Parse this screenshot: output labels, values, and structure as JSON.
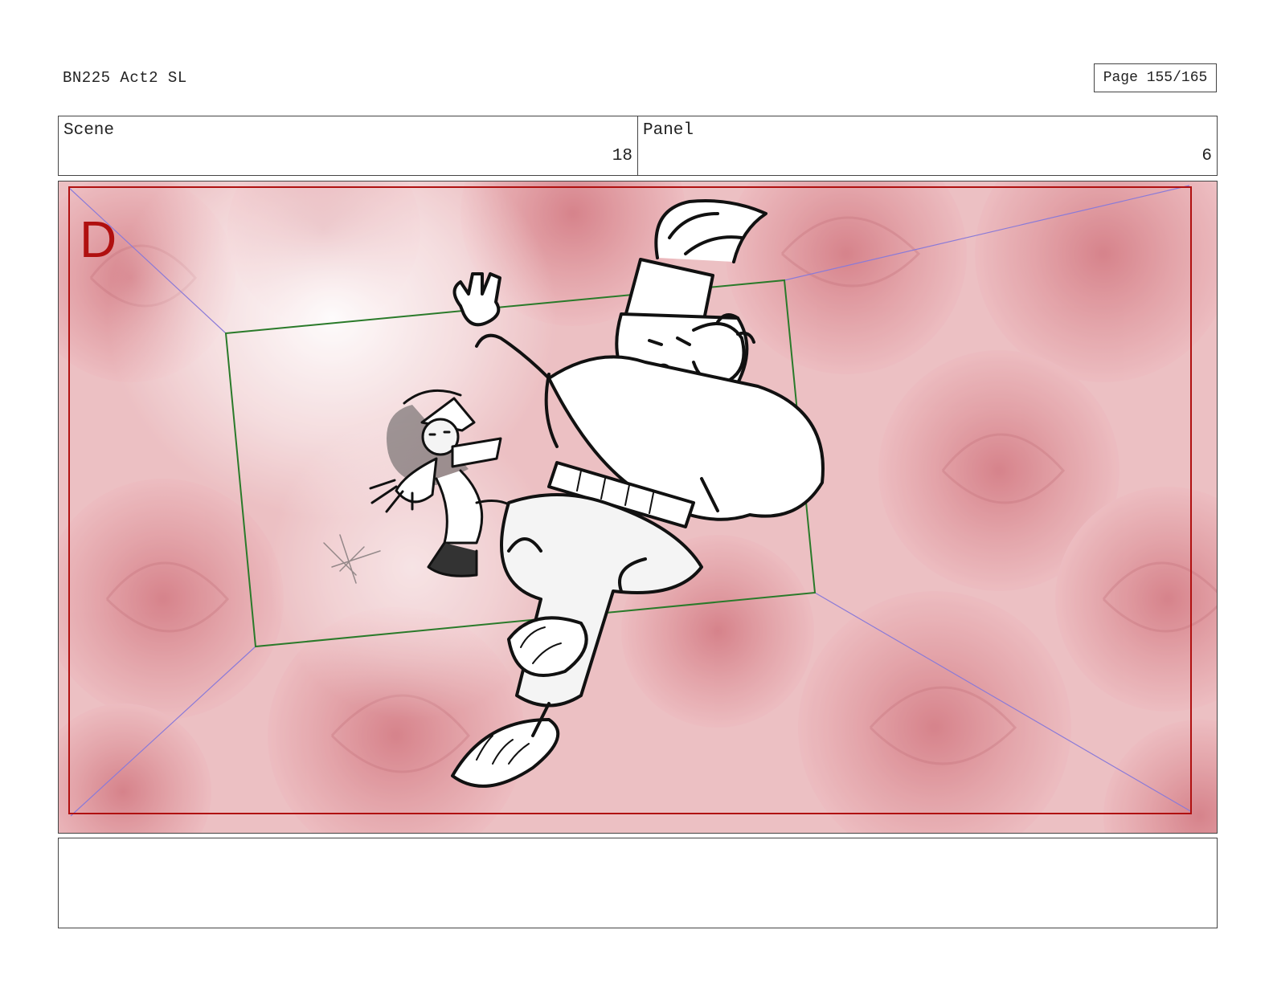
{
  "document": {
    "title": "BN225 Act2 SL",
    "page_label": "Page 155/165"
  },
  "header": {
    "scene_label": "Scene",
    "scene_value": "18",
    "panel_label": "Panel",
    "panel_value": "6"
  },
  "frame": {
    "field_letter": "D",
    "background": "red roses",
    "colors": {
      "safe_frame": "#b01010",
      "camera_frame": "#2a7a2a",
      "guide_lines": "#8a7ad8",
      "field_letter": "#b01010"
    }
  },
  "notes": {
    "text": ""
  }
}
